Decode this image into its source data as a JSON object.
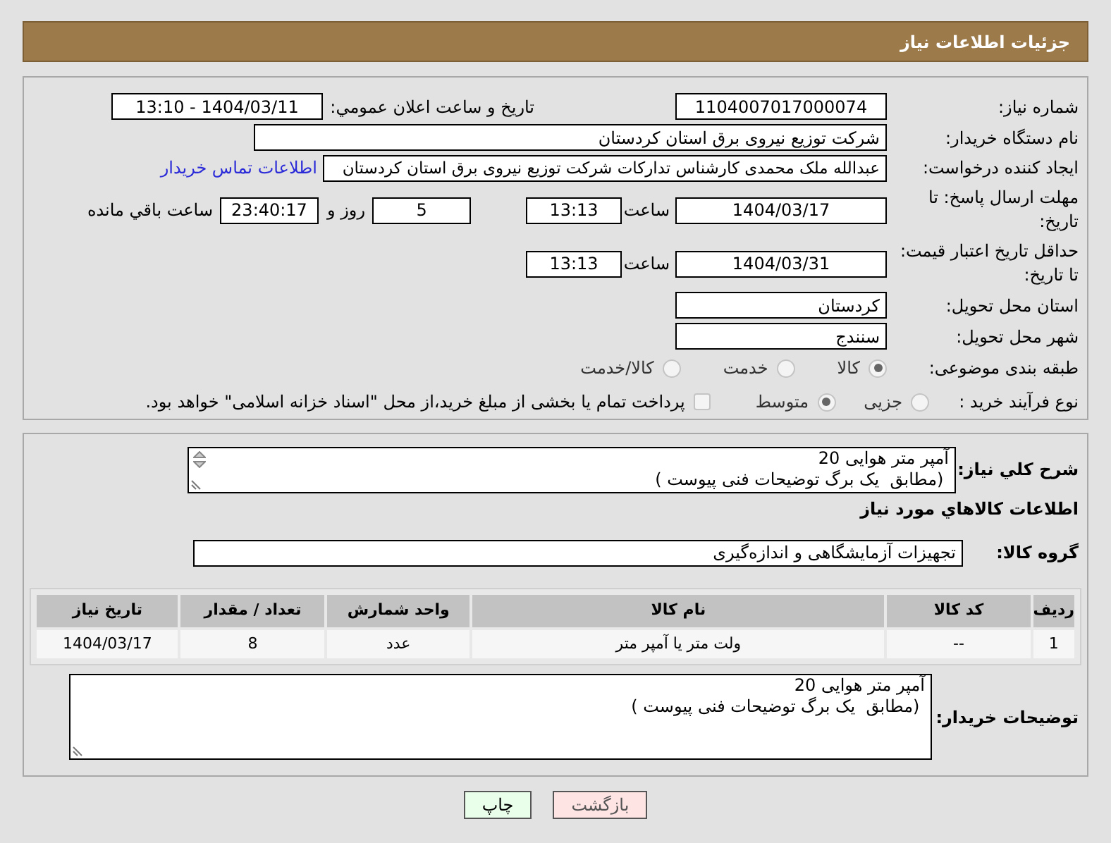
{
  "header": {
    "title": "جزئیات اطلاعات نیاز"
  },
  "details": {
    "need_number": {
      "label": "شماره نیاز:",
      "value": "1104007017000074"
    },
    "announce": {
      "label": "تاریخ و ساعت اعلان عمومي:",
      "value": "1404/03/11 - 13:10"
    },
    "buyer_org": {
      "label": "نام دستگاه خریدار:",
      "value": "شرکت توزیع نیروی برق استان کردستان"
    },
    "creator": {
      "label": "ایجاد کننده درخواست:",
      "value": "عبدالله ملک محمدی کارشناس تدارکات شرکت توزیع نیروی برق استان کردستان",
      "link": "اطلاعات تماس خریدار"
    },
    "response_deadline": {
      "label": "مهلت ارسال پاسخ: تا تاریخ:",
      "date": "1404/03/17",
      "time_label": "ساعت",
      "time": "13:13",
      "days": "5",
      "days_label": "روز و",
      "remaining": "23:40:17",
      "remaining_label": "ساعت باقي مانده"
    },
    "price_validity": {
      "label": "حداقل تاریخ اعتبار قیمت: تا تاریخ:",
      "date": "1404/03/31",
      "time_label": "ساعت",
      "time": "13:13"
    },
    "delivery_province": {
      "label": "استان محل تحویل:",
      "value": "کردستان"
    },
    "delivery_city": {
      "label": "شهر محل تحویل:",
      "value": "سنندج"
    },
    "category": {
      "label": "طبقه بندی موضوعی:",
      "options": [
        {
          "label": "کالا",
          "selected": true
        },
        {
          "label": "خدمت",
          "selected": false
        },
        {
          "label": "کالا/خدمت",
          "selected": false
        }
      ]
    },
    "process": {
      "label": "نوع فرآیند خرید :",
      "options": [
        {
          "label": "جزیی",
          "selected": false
        },
        {
          "label": "متوسط",
          "selected": true
        }
      ],
      "treasury": {
        "label": "پرداخت تمام یا بخشی از مبلغ خرید،از محل \"اسناد خزانه اسلامی\" خواهد بود.",
        "checked": false
      }
    }
  },
  "summary": {
    "label": "شرح کلي نیاز:",
    "text": "آمپر متر هوایی 20\n (مطابق  یک برگ توضیحات فنی پیوست )"
  },
  "goods_heading": "اطلاعات کالاهاي مورد نیاز",
  "goods_group": {
    "label": "گروه کالا:",
    "value": "تجهیزات آزمایشگاهی و اندازه‌گیری"
  },
  "table": {
    "columns": [
      "ردیف",
      "کد کالا",
      "نام کالا",
      "واحد شمارش",
      "تعداد / مقدار",
      "تاریخ نیاز"
    ],
    "rows": [
      [
        "1",
        "--",
        "ولت متر یا آمپر متر",
        "عدد",
        "8",
        "1404/03/17"
      ]
    ]
  },
  "buyer_notes": {
    "label": "توضیحات خریدار:",
    "text": "آمپر متر هوایی 20\n (مطابق  یک برگ توضیحات فنی پیوست )"
  },
  "buttons": [
    {
      "label": "بازگشت",
      "kind": "back"
    },
    {
      "label": "چاپ",
      "kind": "print"
    }
  ]
}
